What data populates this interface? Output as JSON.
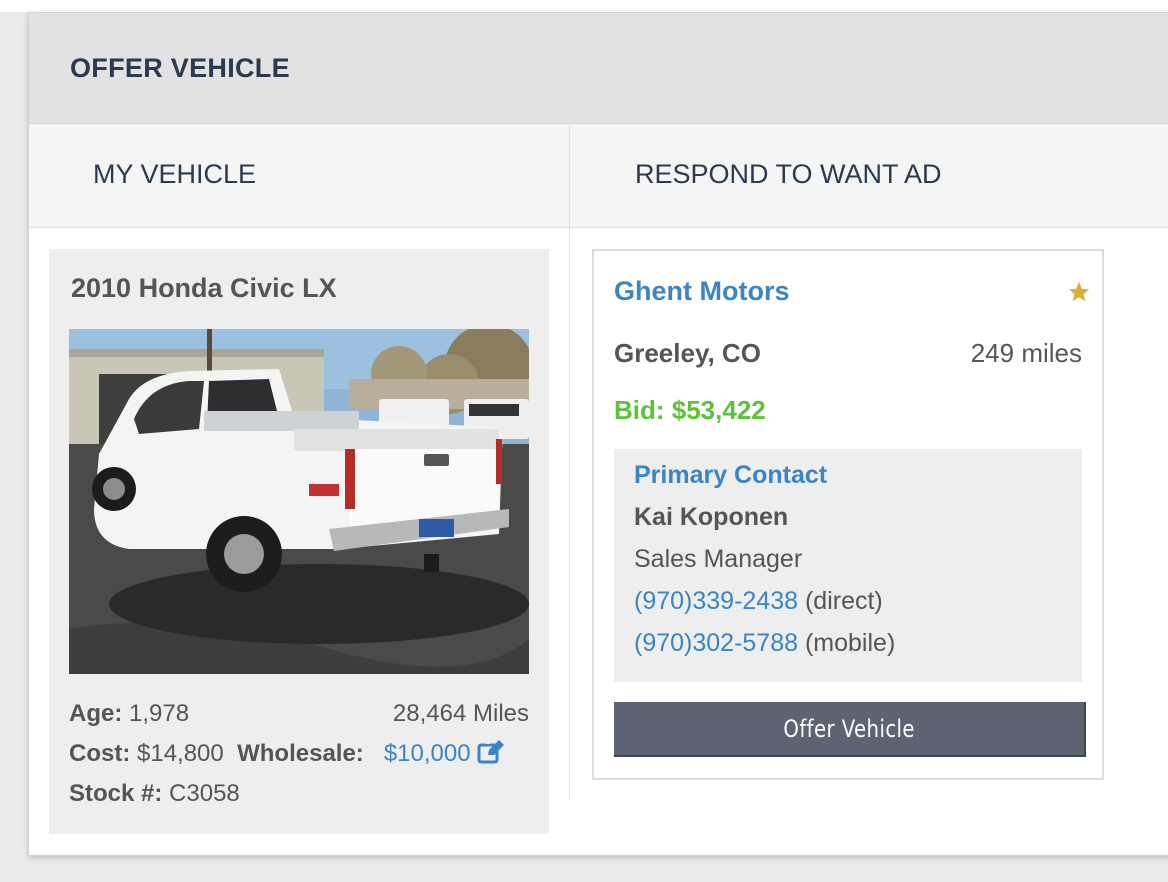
{
  "modal": {
    "title": "OFFER VEHICLE"
  },
  "tabs": [
    {
      "label": "MY VEHICLE"
    },
    {
      "label": "RESPOND TO WANT AD"
    }
  ],
  "vehicle": {
    "title": "2010 Honda Civic LX",
    "age_label": "Age:",
    "age_value": "1,978",
    "miles": "28,464 Miles",
    "cost_label": "Cost:",
    "cost_value": "$14,800",
    "wholesale_label": "Wholesale:",
    "wholesale_value": "$10,000",
    "stock_label": "Stock #:",
    "stock_value": "C3058"
  },
  "dealer": {
    "name": "Ghent Motors",
    "location": "Greeley, CO",
    "distance": "249 miles",
    "bid": "Bid: $53,422",
    "favorite_icon": "star-icon",
    "contact": {
      "heading": "Primary Contact",
      "name": "Kai Koponen",
      "role": "Sales Manager",
      "phone_direct": "(970)339-2438",
      "phone_direct_type": "(direct)",
      "phone_mobile": "(970)302-5788",
      "phone_mobile_type": "(mobile)"
    },
    "offer_button_label": "Offer Vehicle"
  },
  "colors": {
    "accent_blue": "#3a85c6",
    "bid_green": "#5cc236",
    "star_gold": "#d6b23a",
    "button_gray": "#5c6372"
  }
}
